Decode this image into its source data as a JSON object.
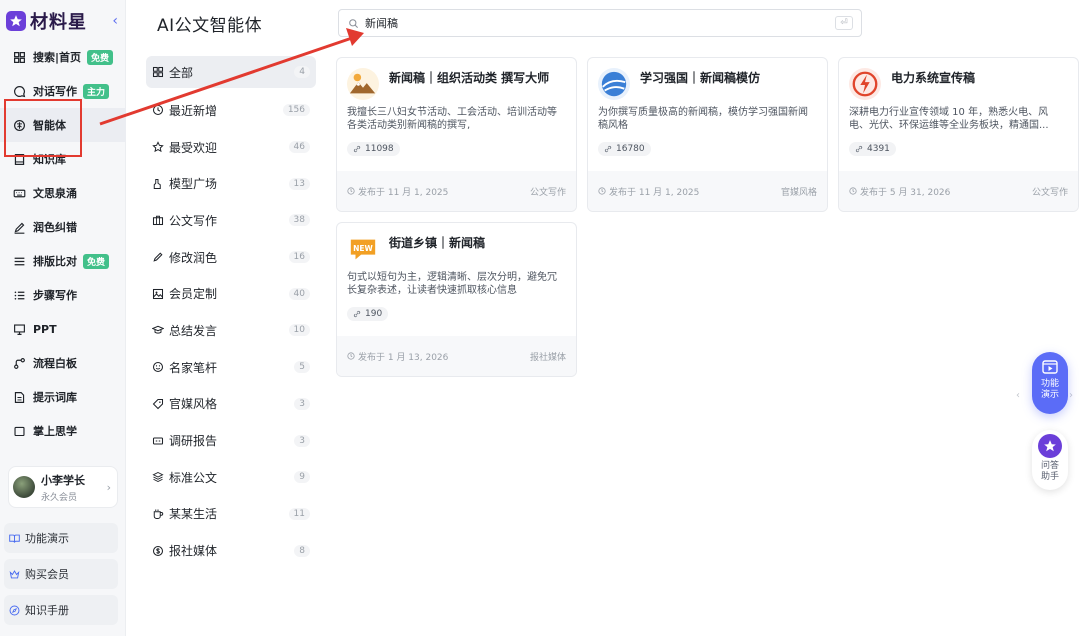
{
  "app": {
    "name": "材料星"
  },
  "sidebar": {
    "items": [
      {
        "label": "搜索|首页",
        "badge": "免费",
        "icon": "grid-icon"
      },
      {
        "label": "对话写作",
        "badge": "主力",
        "icon": "chat-icon"
      },
      {
        "label": "智能体",
        "badge": "",
        "icon": "agent-icon"
      },
      {
        "label": "知识库",
        "badge": "",
        "icon": "book-icon"
      },
      {
        "label": "文思泉涌",
        "badge": "",
        "icon": "keyboard-icon"
      },
      {
        "label": "润色纠错",
        "badge": "",
        "icon": "pen-icon"
      },
      {
        "label": "排版比对",
        "badge": "免费",
        "icon": "lines-icon"
      },
      {
        "label": "步骤写作",
        "badge": "",
        "icon": "steps-icon"
      },
      {
        "label": "PPT",
        "badge": "",
        "icon": "ppt-icon"
      },
      {
        "label": "流程白板",
        "badge": "",
        "icon": "flow-icon"
      },
      {
        "label": "提示词库",
        "badge": "",
        "icon": "doc-icon"
      },
      {
        "label": "掌上思学",
        "badge": "",
        "icon": "tablet-icon"
      }
    ],
    "user": {
      "name": "小李学长",
      "level": "永久会员"
    },
    "bottom": [
      {
        "label": "功能演示",
        "icon": "book-open-icon"
      },
      {
        "label": "购买会员",
        "icon": "crown-icon"
      },
      {
        "label": "知识手册",
        "icon": "compass-icon"
      }
    ]
  },
  "header": {
    "title": "AI公文智能体"
  },
  "search": {
    "value": "新闻稿",
    "placeholder": ""
  },
  "categories": [
    {
      "label": "全部",
      "count": "4",
      "icon": "grid-icon"
    },
    {
      "label": "最近新增",
      "count": "156",
      "icon": "clock-icon"
    },
    {
      "label": "最受欢迎",
      "count": "46",
      "icon": "star-icon"
    },
    {
      "label": "模型广场",
      "count": "13",
      "icon": "model-icon"
    },
    {
      "label": "公文写作",
      "count": "38",
      "icon": "briefcase-icon"
    },
    {
      "label": "修改润色",
      "count": "16",
      "icon": "pencil-icon"
    },
    {
      "label": "会员定制",
      "count": "40",
      "icon": "image-icon"
    },
    {
      "label": "总结发言",
      "count": "10",
      "icon": "cap-icon"
    },
    {
      "label": "名家笔杆",
      "count": "5",
      "icon": "smile-icon"
    },
    {
      "label": "官媒风格",
      "count": "3",
      "icon": "tag-icon"
    },
    {
      "label": "调研报告",
      "count": "3",
      "icon": "report-icon"
    },
    {
      "label": "标准公文",
      "count": "9",
      "icon": "layers-icon"
    },
    {
      "label": "某某生活",
      "count": "11",
      "icon": "cup-icon"
    },
    {
      "label": "报社媒体",
      "count": "8",
      "icon": "dollar-icon"
    }
  ],
  "cards": [
    {
      "title": "新闻稿｜组织活动类 撰写大师",
      "desc": "我擅长三八妇女节活动、工会活动、培训活动等各类活动类别新闻稿的撰写,",
      "uses": "11098",
      "date": "发布于 11 月 1, 2025",
      "tag": "公文写作",
      "icon": "mountain-icon"
    },
    {
      "title": "学习强国｜新闻稿模仿",
      "desc": "为你撰写质量极高的新闻稿，模仿学习强国新闻稿风格",
      "uses": "16780",
      "date": "发布于 11 月 1, 2025",
      "tag": "官媒风格",
      "icon": "globe-icon"
    },
    {
      "title": "电力系统宣传稿",
      "desc": "深耕电力行业宣传领域 10 年，熟悉火电、风电、光伏、环保运维等全业务板块，精通国...",
      "uses": "4391",
      "date": "发布于 5 月 31, 2026",
      "tag": "公文写作",
      "icon": "lightning-icon"
    },
    {
      "title": "街道乡镇｜新闻稿",
      "desc": "句式以短句为主，逻辑清晰、层次分明，避免冗长复杂表述，让读者快速抓取核心信息",
      "uses": "190",
      "date": "发布于 1 月 13, 2026",
      "tag": "报社媒体",
      "icon": "new-badge-icon"
    }
  ],
  "float": {
    "demo_label": "功能演示",
    "help_label": "问答助手"
  },
  "colors": {
    "accent": "#5b6cf7",
    "highlight": "#e23a30",
    "brand": "#6b3fd9",
    "badge_green": "#42c08a"
  }
}
